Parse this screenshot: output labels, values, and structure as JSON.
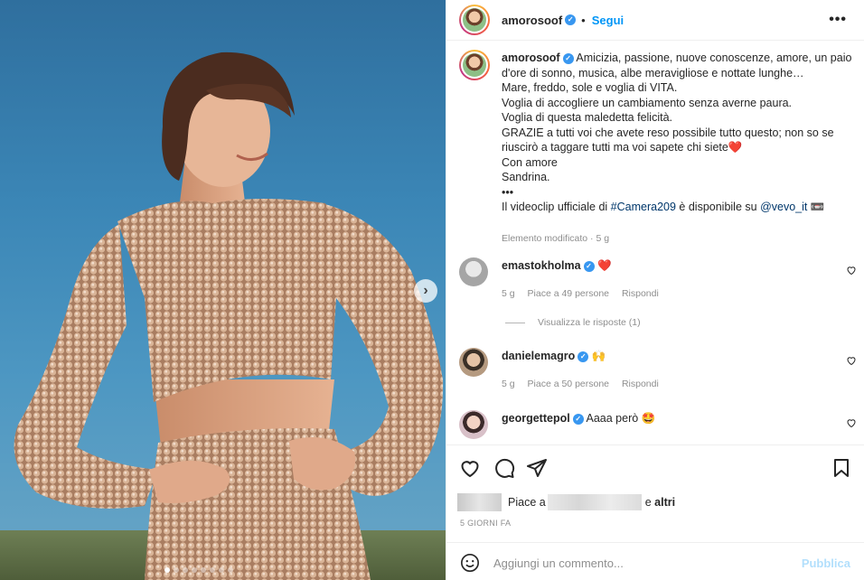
{
  "post": {
    "username": "amorosoof",
    "follow_label": "Segui",
    "separator": "•",
    "more_icon": "more-horizontal-icon",
    "carousel_dots": 8,
    "carousel_active": 0
  },
  "caption": {
    "username": "amorosoof",
    "lines": [
      "Amicizia, passione, nuove conoscenze, amore, un paio d'ore di sonno, musica, albe meravigliose e nottate lunghe…",
      "Mare, freddo, sole e voglia di VITA.",
      "Voglia di accogliere un cambiamento senza averne paura.",
      "Voglia di questa maledetta felicità.",
      "GRAZIE a tutti voi che avete reso possibile tutto questo; non so se riuscirò a taggare tutti ma voi sapete chi siete❤️",
      "Con amore",
      "Sandrina.",
      "•••"
    ],
    "last_line_prefix": "Il videoclip ufficiale di ",
    "hashtag": "#Camera209",
    "last_line_mid": " è disponibile su ",
    "mention": "@vevo_it",
    "last_line_suffix": " 📼",
    "meta": "Elemento modificato · 5 g"
  },
  "comments": [
    {
      "username": "emastokholma",
      "text": "❤️",
      "time": "5 g",
      "likes": "Piace a 49 persone",
      "reply": "Rispondi",
      "avatar_color": "#c9c9c9"
    },
    {
      "username": "danielemagro",
      "text": "🙌",
      "time": "5 g",
      "likes": "Piace a 50 persone",
      "reply": "Rispondi",
      "avatar_color": "#b59a80"
    },
    {
      "username": "georgettepol",
      "text": "Aaaa però 🤩",
      "avatar_color": "#d8c0c8"
    }
  ],
  "view_replies": "Visualizza le risposte (1)",
  "likes": {
    "prefix": "Piace a",
    "suffix": "e",
    "others": "altri"
  },
  "date_label": "5 GIORNI FA",
  "add_comment": {
    "placeholder": "Aggiungi un commento...",
    "publish_label": "Pubblica"
  },
  "colors": {
    "accent": "#0095f6",
    "verified": "#3897f0",
    "publish_disabled": "#b2dffc",
    "muted": "#8e8e8e"
  }
}
